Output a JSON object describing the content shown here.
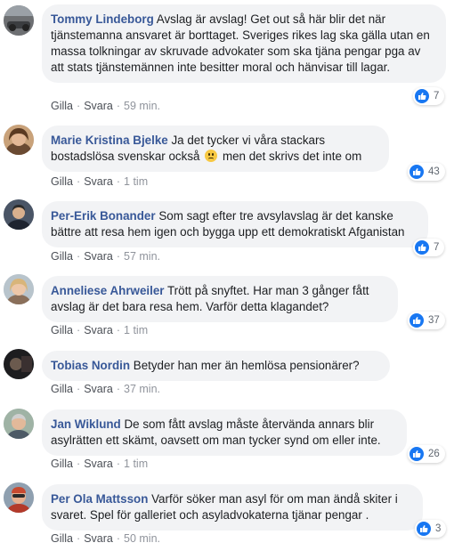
{
  "actions": {
    "like": "Gilla",
    "reply": "Svara",
    "separator": "·"
  },
  "comments": [
    {
      "name": "Tommy Lindeborg",
      "text": "Avslag är avslag! Get out så här blir det när tjänstemanna ansvaret är borttaget. Sveriges rikes lag ska gälla utan en massa tolkningar av skruvade advokater som ska tjäna pengar pga av att stats tjänstemännen inte besitter moral och hänvisar till lagar.",
      "time": "59 min.",
      "likes": "7"
    },
    {
      "name": "Marie Kristina Bjelke",
      "text": "Ja det tycker vi våra stackars bostadslösa svenskar också",
      "text_after": "men det skrivs det inte om",
      "emoji": "frowning-face",
      "time": "1 tim",
      "likes": "43"
    },
    {
      "name": "Per-Erik Bonander",
      "text": "Som sagt efter tre avsylavslag är det kanske bättre att resa hem igen och bygga upp ett demokratiskt Afganistan",
      "time": "57 min.",
      "likes": "7"
    },
    {
      "name": "Anneliese Ahrweiler",
      "text": "Trött på snyftet. Har man 3 gånger fått avslag är det bara resa hem. Varför detta klagandet?",
      "time": "1 tim",
      "likes": "37"
    },
    {
      "name": "Tobias Nordin",
      "text": "Betyder han mer än hemlösa pensionärer?",
      "time": "37 min."
    },
    {
      "name": "Jan Wiklund",
      "text": "De som fått avslag måste återvända annars blir asylrätten ett skämt, oavsett om man tycker synd om eller inte.",
      "time": "1 tim",
      "likes": "26"
    },
    {
      "name": "Per Ola Mattsson",
      "text": "Varför söker man asyl för om man ändå skiter i svaret. Spel för galleriet och asyladvokaterna tjänar pengar .",
      "time": "50 min.",
      "likes": "3"
    }
  ],
  "colors": {
    "name_link": "#385898",
    "bubble_bg": "#f2f3f5",
    "like_blue": "#1877f2",
    "meta_grey": "#90949c"
  },
  "icons": {
    "like": "thumbs-up-icon"
  }
}
